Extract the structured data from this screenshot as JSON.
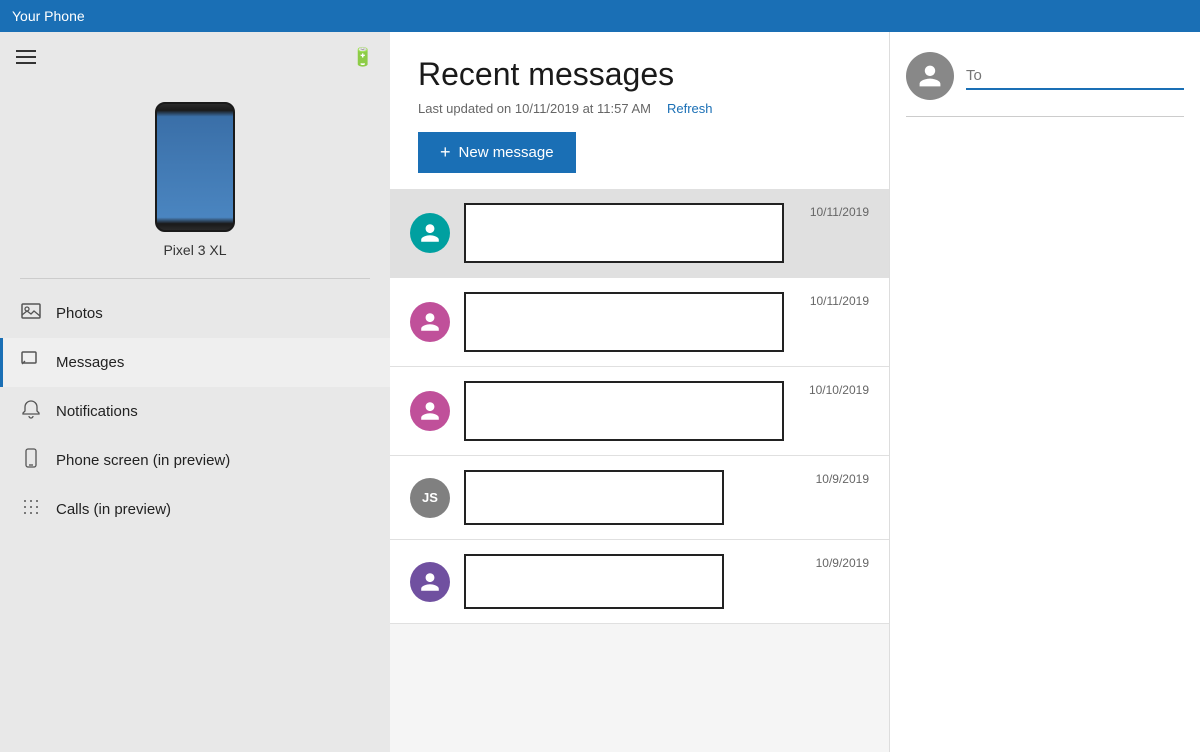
{
  "titleBar": {
    "label": "Your Phone"
  },
  "sidebar": {
    "deviceName": "Pixel 3 XL",
    "navItems": [
      {
        "id": "photos",
        "label": "Photos",
        "icon": "photos"
      },
      {
        "id": "messages",
        "label": "Messages",
        "icon": "messages",
        "active": true
      },
      {
        "id": "notifications",
        "label": "Notifications",
        "icon": "notifications"
      },
      {
        "id": "phone-screen",
        "label": "Phone screen (in preview)",
        "icon": "phone-screen"
      },
      {
        "id": "calls",
        "label": "Calls (in preview)",
        "icon": "calls"
      }
    ]
  },
  "messagesPanel": {
    "title": "Recent messages",
    "lastUpdated": "Last updated on 10/11/2019 at 11:57 AM",
    "refreshLabel": "Refresh",
    "newMessageLabel": "New message",
    "messages": [
      {
        "avatarType": "teal",
        "avatarText": "",
        "date": "10/11/2019"
      },
      {
        "avatarType": "pink",
        "avatarText": "",
        "date": "10/11/2019"
      },
      {
        "avatarType": "pink",
        "avatarText": "",
        "date": "10/10/2019"
      },
      {
        "avatarType": "gray",
        "avatarText": "JS",
        "date": "10/9/2019"
      },
      {
        "avatarType": "purple",
        "avatarText": "",
        "date": "10/9/2019"
      }
    ]
  },
  "composePanel": {
    "toPlaceholder": "To",
    "avatarIcon": "👤"
  }
}
